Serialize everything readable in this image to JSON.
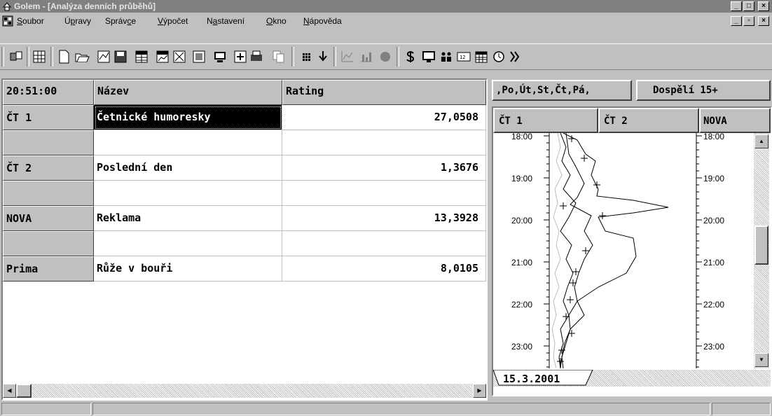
{
  "window": {
    "title": "Golem - [Analýza denních průběhů]"
  },
  "menu": {
    "items": [
      {
        "pre": "",
        "u": "S",
        "post": "oubor"
      },
      {
        "pre": "Ú",
        "u": "p",
        "post": "ravy"
      },
      {
        "pre": "Správ",
        "u": "c",
        "post": "e"
      },
      {
        "pre": "",
        "u": "V",
        "post": "ýpočet"
      },
      {
        "pre": "N",
        "u": "a",
        "post": "stavení"
      },
      {
        "pre": "",
        "u": "O",
        "post": "kno"
      },
      {
        "pre": "",
        "u": "N",
        "post": "ápověda"
      }
    ]
  },
  "grid": {
    "time": "20:51:00",
    "col_name": "Název",
    "col_rating": "Rating",
    "rows": [
      {
        "channel": "ČT 1",
        "name": "Četnické humoresky",
        "rating": "27,0508",
        "selected": true
      },
      {
        "channel": "",
        "name": "",
        "rating": ""
      },
      {
        "channel": "ČT 2",
        "name": "Poslední den",
        "rating": "1,3676"
      },
      {
        "channel": "",
        "name": "",
        "rating": ""
      },
      {
        "channel": "NOVA",
        "name": "Reklama",
        "rating": "13,3928"
      },
      {
        "channel": "",
        "name": "",
        "rating": ""
      },
      {
        "channel": "Prima",
        "name": "Růže v bouři",
        "rating": "8,0105"
      }
    ]
  },
  "chart_panel": {
    "days_filter": ",Po,Út,St,Čt,Pá,",
    "audience": "Dospělí 15+",
    "channels": [
      "ČT 1",
      "ČT 2",
      "NOVA"
    ],
    "time_labels": [
      "18:00",
      "19:00",
      "20:00",
      "21:00",
      "22:00",
      "23:00"
    ],
    "date_tab": "15.3.2001"
  }
}
